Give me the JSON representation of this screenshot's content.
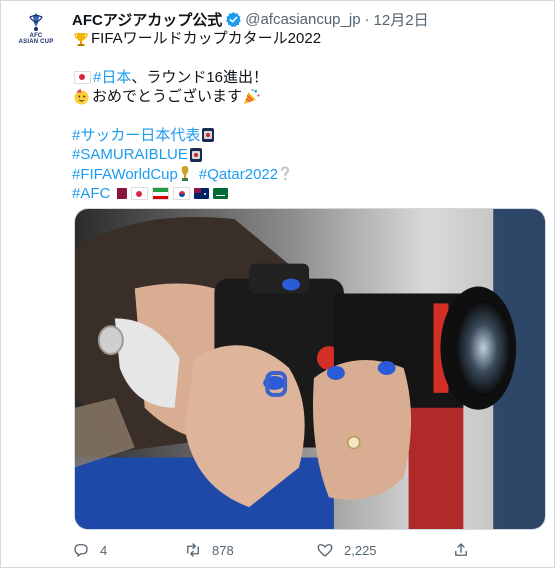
{
  "account": {
    "name": "AFCアジアカップ公式",
    "handle": "@afcasiancup_jp",
    "separator": "·",
    "date": "12月2日",
    "avatar_text_1": "AFC",
    "avatar_text_2": "ASIAN CUP"
  },
  "tweet": {
    "line1": "FIFAワールドカップカタール2022",
    "line2_tag": "#日本",
    "line2_text": "、ラウンド16進出！",
    "line3": "おめでとうございます",
    "tags": {
      "soccer_japan": "#サッカー日本代表",
      "samurai": "#SAMURAIBLUE",
      "fifa": "#FIFAWorldCup",
      "qatar": "#Qatar2022",
      "afc": "#AFC"
    }
  },
  "icons": {
    "trophy": "trophy-icon",
    "verified": "verified-badge-icon",
    "reply": "reply-icon",
    "retweet": "retweet-icon",
    "like": "heart-icon",
    "share": "share-icon"
  },
  "actions": {
    "replies": "4",
    "retweets": "878",
    "likes": "2,225"
  },
  "colors": {
    "link": "#1d9bf0",
    "secondary_text": "#536471",
    "verified": "#1d9bf0"
  }
}
